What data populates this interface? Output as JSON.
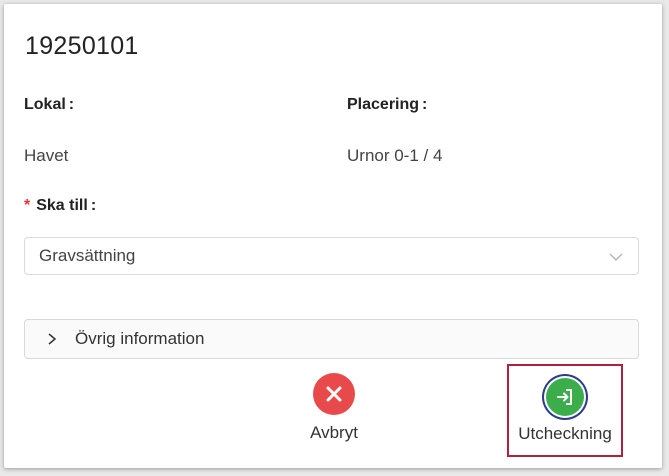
{
  "dialog": {
    "title": "19250101",
    "lokal_label": "Lokal",
    "lokal_value": "Havet",
    "placering_label": "Placering",
    "placering_value": "Urnor 0-1 / 4",
    "colon": ":",
    "required_mark": "*",
    "ska_till_label": "Ska till",
    "ska_till_value": "Gravsättning",
    "ovrig_label": "Övrig information"
  },
  "actions": {
    "cancel_label": "Avbryt",
    "checkout_label": "Utcheckning"
  },
  "colors": {
    "cancel": "#e8494a",
    "checkout": "#3cad4b",
    "required": "#e0343b",
    "highlight_border": "#b0213c"
  },
  "icons": {
    "cancel": "close-icon",
    "checkout": "sign-in-icon",
    "select": "chevron-down-icon",
    "collapse": "chevron-right-icon"
  }
}
